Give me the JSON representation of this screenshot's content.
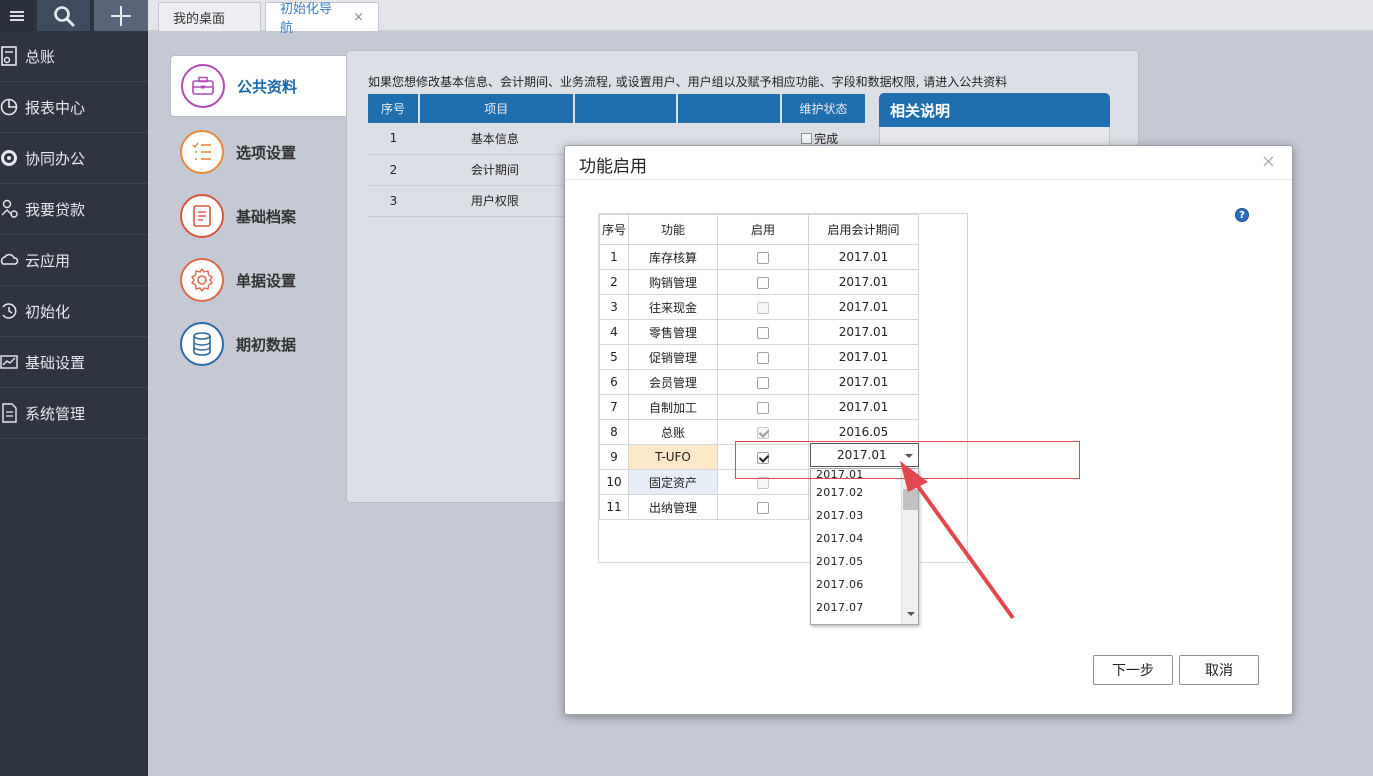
{
  "sidebar": {
    "items": [
      {
        "label": "总账",
        "icon": "ledger-icon"
      },
      {
        "label": "报表中心",
        "icon": "pie-chart-icon"
      },
      {
        "label": "协同办公",
        "icon": "sync-icon"
      },
      {
        "label": "我要贷款",
        "icon": "loan-icon"
      },
      {
        "label": "云应用",
        "icon": "cloud-icon"
      },
      {
        "label": "初始化",
        "icon": "reset-icon"
      },
      {
        "label": "基础设置",
        "icon": "settings-chart-icon"
      },
      {
        "label": "系统管理",
        "icon": "system-doc-icon"
      }
    ]
  },
  "tabs": [
    {
      "label": "我的桌面"
    },
    {
      "label": "初始化导航",
      "close": "×"
    }
  ],
  "nav": {
    "items": [
      {
        "label": "公共资料",
        "color": "#b04ab5"
      },
      {
        "label": "选项设置",
        "color": "#e8883a"
      },
      {
        "label": "基础档案",
        "color": "#d5573b"
      },
      {
        "label": "单据设置",
        "color": "#d66a4a"
      },
      {
        "label": "期初数据",
        "color": "#2c6aa6"
      }
    ]
  },
  "content": {
    "intro": "如果您想修改基本信息、会计期间、业务流程, 或设置用户、用户组以及赋予相应功能、字段和数据权限, 请进入公共资料",
    "headers": [
      "序号",
      "项目",
      "",
      "",
      "维护状态"
    ],
    "rows": [
      {
        "no": "1",
        "name": "基本信息",
        "status": "完成"
      },
      {
        "no": "2",
        "name": "会计期间"
      },
      {
        "no": "3",
        "name": "用户权限"
      }
    ],
    "note_title": "相关说明"
  },
  "dialog": {
    "title": "功能启用",
    "close": "×",
    "help": "?",
    "headers": [
      "序号",
      "功能",
      "启用",
      "启用会计期间"
    ],
    "rows": [
      {
        "no": "1",
        "name": "库存核算",
        "enabled": false,
        "disabled": false,
        "period": "2017.01"
      },
      {
        "no": "2",
        "name": "购销管理",
        "enabled": false,
        "disabled": false,
        "period": "2017.01"
      },
      {
        "no": "3",
        "name": "往来现金",
        "enabled": false,
        "disabled": true,
        "period": "2017.01"
      },
      {
        "no": "4",
        "name": "零售管理",
        "enabled": false,
        "disabled": false,
        "period": "2017.01"
      },
      {
        "no": "5",
        "name": "促销管理",
        "enabled": false,
        "disabled": false,
        "period": "2017.01"
      },
      {
        "no": "6",
        "name": "会员管理",
        "enabled": false,
        "disabled": false,
        "period": "2017.01"
      },
      {
        "no": "7",
        "name": "自制加工",
        "enabled": false,
        "disabled": false,
        "period": "2017.01"
      },
      {
        "no": "8",
        "name": "总账",
        "enabled": true,
        "disabled": true,
        "period": "2016.05"
      },
      {
        "no": "9",
        "name": "T-UFO",
        "enabled": true,
        "disabled": false,
        "period": "2017.01"
      },
      {
        "no": "10",
        "name": "固定资产",
        "enabled": false,
        "disabled": true,
        "period": ""
      },
      {
        "no": "11",
        "name": "出纳管理",
        "enabled": false,
        "disabled": false,
        "period": ""
      }
    ],
    "select_value": "2017.01",
    "dropdown_options": [
      "2017.01",
      "2017.02",
      "2017.03",
      "2017.04",
      "2017.05",
      "2017.06",
      "2017.07"
    ],
    "next_label": "下一步",
    "cancel_label": "取消"
  },
  "colors": {
    "accent": "#1f6fae",
    "annotation": "#e2474d",
    "selected_row": "#fde8c8"
  }
}
